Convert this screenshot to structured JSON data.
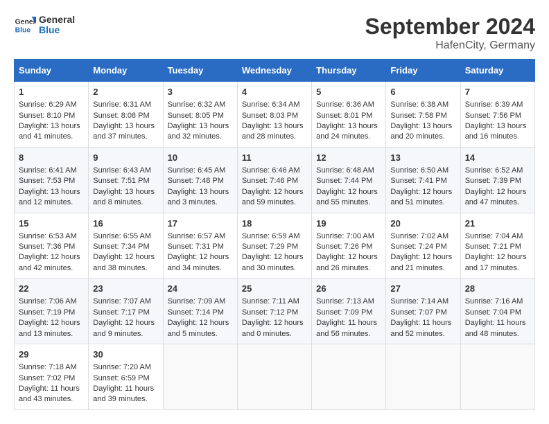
{
  "header": {
    "logo_line1": "General",
    "logo_line2": "Blue",
    "month": "September 2024",
    "location": "HafenCity, Germany"
  },
  "weekdays": [
    "Sunday",
    "Monday",
    "Tuesday",
    "Wednesday",
    "Thursday",
    "Friday",
    "Saturday"
  ],
  "weeks": [
    [
      {
        "day": "1",
        "rise": "Sunrise: 6:29 AM",
        "set": "Sunset: 8:10 PM",
        "daylight": "Daylight: 13 hours and 41 minutes."
      },
      {
        "day": "2",
        "rise": "Sunrise: 6:31 AM",
        "set": "Sunset: 8:08 PM",
        "daylight": "Daylight: 13 hours and 37 minutes."
      },
      {
        "day": "3",
        "rise": "Sunrise: 6:32 AM",
        "set": "Sunset: 8:05 PM",
        "daylight": "Daylight: 13 hours and 32 minutes."
      },
      {
        "day": "4",
        "rise": "Sunrise: 6:34 AM",
        "set": "Sunset: 8:03 PM",
        "daylight": "Daylight: 13 hours and 28 minutes."
      },
      {
        "day": "5",
        "rise": "Sunrise: 6:36 AM",
        "set": "Sunset: 8:01 PM",
        "daylight": "Daylight: 13 hours and 24 minutes."
      },
      {
        "day": "6",
        "rise": "Sunrise: 6:38 AM",
        "set": "Sunset: 7:58 PM",
        "daylight": "Daylight: 13 hours and 20 minutes."
      },
      {
        "day": "7",
        "rise": "Sunrise: 6:39 AM",
        "set": "Sunset: 7:56 PM",
        "daylight": "Daylight: 13 hours and 16 minutes."
      }
    ],
    [
      {
        "day": "8",
        "rise": "Sunrise: 6:41 AM",
        "set": "Sunset: 7:53 PM",
        "daylight": "Daylight: 13 hours and 12 minutes."
      },
      {
        "day": "9",
        "rise": "Sunrise: 6:43 AM",
        "set": "Sunset: 7:51 PM",
        "daylight": "Daylight: 13 hours and 8 minutes."
      },
      {
        "day": "10",
        "rise": "Sunrise: 6:45 AM",
        "set": "Sunset: 7:48 PM",
        "daylight": "Daylight: 13 hours and 3 minutes."
      },
      {
        "day": "11",
        "rise": "Sunrise: 6:46 AM",
        "set": "Sunset: 7:46 PM",
        "daylight": "Daylight: 12 hours and 59 minutes."
      },
      {
        "day": "12",
        "rise": "Sunrise: 6:48 AM",
        "set": "Sunset: 7:44 PM",
        "daylight": "Daylight: 12 hours and 55 minutes."
      },
      {
        "day": "13",
        "rise": "Sunrise: 6:50 AM",
        "set": "Sunset: 7:41 PM",
        "daylight": "Daylight: 12 hours and 51 minutes."
      },
      {
        "day": "14",
        "rise": "Sunrise: 6:52 AM",
        "set": "Sunset: 7:39 PM",
        "daylight": "Daylight: 12 hours and 47 minutes."
      }
    ],
    [
      {
        "day": "15",
        "rise": "Sunrise: 6:53 AM",
        "set": "Sunset: 7:36 PM",
        "daylight": "Daylight: 12 hours and 42 minutes."
      },
      {
        "day": "16",
        "rise": "Sunrise: 6:55 AM",
        "set": "Sunset: 7:34 PM",
        "daylight": "Daylight: 12 hours and 38 minutes."
      },
      {
        "day": "17",
        "rise": "Sunrise: 6:57 AM",
        "set": "Sunset: 7:31 PM",
        "daylight": "Daylight: 12 hours and 34 minutes."
      },
      {
        "day": "18",
        "rise": "Sunrise: 6:59 AM",
        "set": "Sunset: 7:29 PM",
        "daylight": "Daylight: 12 hours and 30 minutes."
      },
      {
        "day": "19",
        "rise": "Sunrise: 7:00 AM",
        "set": "Sunset: 7:26 PM",
        "daylight": "Daylight: 12 hours and 26 minutes."
      },
      {
        "day": "20",
        "rise": "Sunrise: 7:02 AM",
        "set": "Sunset: 7:24 PM",
        "daylight": "Daylight: 12 hours and 21 minutes."
      },
      {
        "day": "21",
        "rise": "Sunrise: 7:04 AM",
        "set": "Sunset: 7:21 PM",
        "daylight": "Daylight: 12 hours and 17 minutes."
      }
    ],
    [
      {
        "day": "22",
        "rise": "Sunrise: 7:06 AM",
        "set": "Sunset: 7:19 PM",
        "daylight": "Daylight: 12 hours and 13 minutes."
      },
      {
        "day": "23",
        "rise": "Sunrise: 7:07 AM",
        "set": "Sunset: 7:17 PM",
        "daylight": "Daylight: 12 hours and 9 minutes."
      },
      {
        "day": "24",
        "rise": "Sunrise: 7:09 AM",
        "set": "Sunset: 7:14 PM",
        "daylight": "Daylight: 12 hours and 5 minutes."
      },
      {
        "day": "25",
        "rise": "Sunrise: 7:11 AM",
        "set": "Sunset: 7:12 PM",
        "daylight": "Daylight: 12 hours and 0 minutes."
      },
      {
        "day": "26",
        "rise": "Sunrise: 7:13 AM",
        "set": "Sunset: 7:09 PM",
        "daylight": "Daylight: 11 hours and 56 minutes."
      },
      {
        "day": "27",
        "rise": "Sunrise: 7:14 AM",
        "set": "Sunset: 7:07 PM",
        "daylight": "Daylight: 11 hours and 52 minutes."
      },
      {
        "day": "28",
        "rise": "Sunrise: 7:16 AM",
        "set": "Sunset: 7:04 PM",
        "daylight": "Daylight: 11 hours and 48 minutes."
      }
    ],
    [
      {
        "day": "29",
        "rise": "Sunrise: 7:18 AM",
        "set": "Sunset: 7:02 PM",
        "daylight": "Daylight: 11 hours and 43 minutes."
      },
      {
        "day": "30",
        "rise": "Sunrise: 7:20 AM",
        "set": "Sunset: 6:59 PM",
        "daylight": "Daylight: 11 hours and 39 minutes."
      },
      null,
      null,
      null,
      null,
      null
    ]
  ]
}
